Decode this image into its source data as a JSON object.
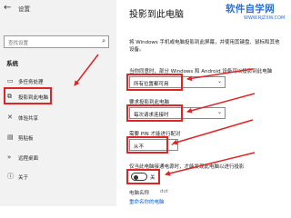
{
  "app": {
    "back_icon": "back-arrow-icon",
    "title": "设置"
  },
  "sidebar": {
    "search_placeholder": "查找设置",
    "search_icon": "search-icon",
    "section_label": "系统",
    "items": [
      {
        "label": "多任务处理",
        "icon": "multitask-icon"
      },
      {
        "label": "投影到此电脑",
        "icon": "project-icon",
        "selected": true
      },
      {
        "label": "体验共享",
        "icon": "shared-experience-icon"
      },
      {
        "label": "剪贴板",
        "icon": "clipboard-icon"
      },
      {
        "label": "远程桌面",
        "icon": "remote-desktop-icon"
      },
      {
        "label": "关于",
        "icon": "info-icon"
      }
    ]
  },
  "main": {
    "title": "投影到此电脑",
    "watermark": {
      "main": "软件自学网",
      "sub": "WWW.RJZXW.COM"
    },
    "intro": "将 Windows 手机或电脑投影到此屏幕，并使用其键盘、鼠标和其他设备。",
    "when_label": "当你同意时，部分 Windows 和 Android 设备可以投影到此电脑",
    "when_value": "所有位置都可用",
    "ask_label": "要求投影到此电脑",
    "ask_value": "每次请求连接时",
    "pin_label": "需要 PIN 才能进行配对",
    "pin_value": "从不",
    "power_label": "仅当此电脑接通电源时，才能发现此电脑以进行投影",
    "toggle_state": "关",
    "toggle_on": false,
    "pc_name_label": "电脑名称",
    "pc_name_value": "dot",
    "rename_link": "重命名你的电脑"
  },
  "colors": {
    "accent": "#e02525",
    "link": "#0a5ec9",
    "watermark": "#2b6fd4",
    "sidebar_bg": "#f2f2f2"
  }
}
